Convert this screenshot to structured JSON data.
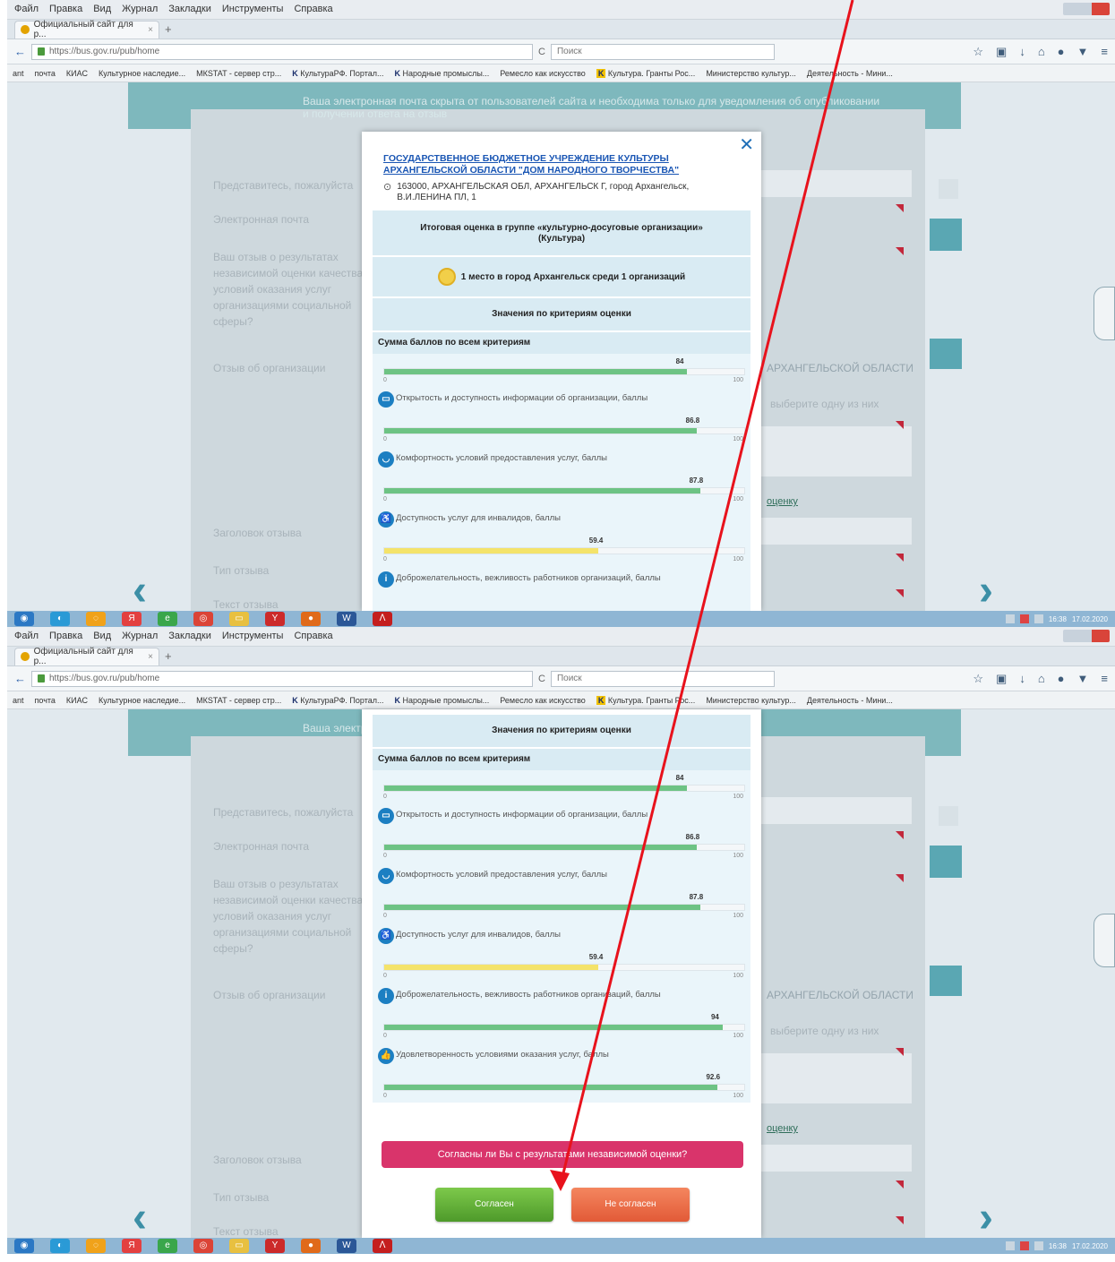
{
  "browser": {
    "menu": [
      "Файл",
      "Правка",
      "Вид",
      "Журнал",
      "Закладки",
      "Инструменты",
      "Справка"
    ],
    "tab_title": "Официальный сайт для р...",
    "url": "https://bus.gov.ru/pub/home",
    "search_placeholder": "Поиск",
    "bookmarks": [
      {
        "label": "ant",
        "style": "plain"
      },
      {
        "label": "почта",
        "style": "plain"
      },
      {
        "label": "КИАС",
        "style": "plain"
      },
      {
        "label": "Культурное наследие...",
        "style": "plain"
      },
      {
        "label": "МКSTAT - сервер стр...",
        "style": "plain"
      },
      {
        "label": "КультураРФ. Портал...",
        "style": "k"
      },
      {
        "label": "Народные промыслы...",
        "style": "k"
      },
      {
        "label": "Ремесло как искусство",
        "style": "plain"
      },
      {
        "label": "Культура. Гранты Рос...",
        "style": "ky"
      },
      {
        "label": "Министерство культур...",
        "style": "plain"
      },
      {
        "label": "Деятельность - Мини...",
        "style": "plain"
      }
    ]
  },
  "background_form": {
    "notice": "Ваша электронная почта скрыта от пользователей сайта и необходима только для уведомления об опубликовании и получении ответа на отзыв",
    "notice2": "Ваша электронная почта скрыта",
    "fields": [
      "Представитесь, пожалуйста",
      "Электронная почта",
      "Ваш отзыв о результатах независимой оценки качества условий оказания услуг организациями социальной сферы?",
      "Отзыв об организации"
    ],
    "selected_org": "АРХАНГЕЛЬСКОЙ ОБЛАСТИ",
    "hint": "выберите одну из них",
    "link": "оценку",
    "title_field": "Заголовок отзыва",
    "type_field": "Тип отзыва",
    "text_field": "Текст отзыва"
  },
  "modal": {
    "org_name": "ГОСУДАРСТВЕННОЕ БЮДЖЕТНОЕ УЧРЕЖДЕНИЕ КУЛЬТУРЫ АРХАНГЕЛЬСКОЙ ОБЛАСТИ \"ДОМ НАРОДНОГО ТВОРЧЕСТВА\"",
    "address": "163000, АРХАНГЕЛЬСКАЯ ОБЛ, АРХАНГЕЛЬСК Г, город Архангельск, В.И.ЛЕНИНА ПЛ, 1",
    "group_title": "Итоговая оценка в группе «культурно-досуговые организации» (Культура)",
    "rank": "1 место в город Архангельск среди 1 организаций",
    "criteria_title": "Значения по критериям оценки",
    "sum_label": "Сумма баллов по всем критериям",
    "sum_value": 84,
    "scale_min": "0",
    "scale_max": "100",
    "criteria": [
      {
        "label": "Открытость и доступность информации об организации, баллы",
        "value": 86.8,
        "icon": "info-monitor-icon",
        "color": "#6dc384"
      },
      {
        "label": "Комфортность условий предоставления услуг, баллы",
        "value": 87.8,
        "icon": "comfort-sofa-icon",
        "color": "#6dc384"
      },
      {
        "label": "Доступность услуг для инвалидов, баллы",
        "value": 59.4,
        "icon": "wheelchair-icon",
        "color": "#f4e36a"
      },
      {
        "label": "Доброжелательность, вежливость работников организаций, баллы",
        "value": 94,
        "icon": "info-i-icon",
        "color": "#6dc384"
      },
      {
        "label": "Удовлетворенность условиями оказания услуг, баллы",
        "value": 92.6,
        "icon": "thumbs-up-icon",
        "color": "#6dc384"
      }
    ],
    "value_labels": [
      "84",
      "86.8",
      "87.8",
      "59.4",
      "94",
      "92.6"
    ],
    "question": "Согласны ли Вы с результатами независимой оценки?",
    "agree_label": "Согласен",
    "disagree_label": "Не согласен"
  },
  "taskbar": {
    "time": "16:38",
    "date": "17.02.2020"
  },
  "annotation": {
    "color": "#e8121c"
  }
}
